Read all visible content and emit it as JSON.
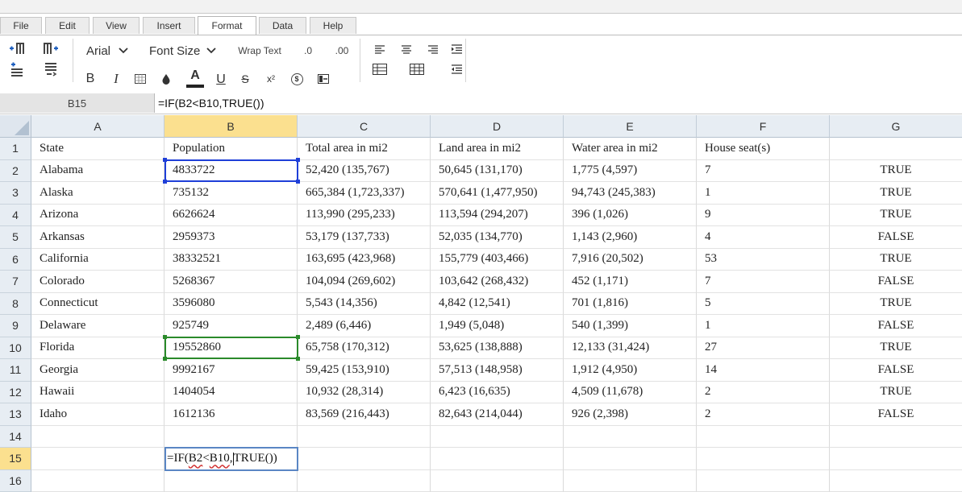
{
  "menu": {
    "tabs": [
      {
        "label": "File"
      },
      {
        "label": "Edit"
      },
      {
        "label": "View"
      },
      {
        "label": "Insert"
      },
      {
        "label": "Format"
      },
      {
        "label": "Data"
      },
      {
        "label": "Help"
      }
    ],
    "active_tab": "Format"
  },
  "toolbar": {
    "font_family": "Arial",
    "font_size": "Font Size",
    "wrap_text": "Wrap Text",
    "decimal_decrease": ".0",
    "decimal_increase": ".00",
    "bold": "B",
    "italic": "I",
    "underline": "U",
    "strike": "S",
    "superscript": "x²",
    "text_color_glyph": "A",
    "currency_glyph": "$"
  },
  "formula_bar": {
    "cell_ref": "B15",
    "formula": "=IF(B2<B10,TRUE())"
  },
  "sheet": {
    "columns": [
      "A",
      "B",
      "C",
      "D",
      "E",
      "F",
      "G"
    ],
    "selected_column": "B",
    "selected_row": "15",
    "rows": [
      {
        "num": "1",
        "cells": [
          "State",
          "Population",
          "Total area in mi2",
          "Land area in mi2",
          "Water area in mi2",
          "House seat(s)",
          ""
        ]
      },
      {
        "num": "2",
        "cells": [
          "Alabama",
          "4833722",
          "52,420 (135,767)",
          "50,645 (131,170)",
          "1,775 (4,597)",
          "7",
          "TRUE"
        ]
      },
      {
        "num": "3",
        "cells": [
          "Alaska",
          "735132",
          "665,384 (1,723,337)",
          "570,641 (1,477,950)",
          "94,743 (245,383)",
          "1",
          "TRUE"
        ]
      },
      {
        "num": "4",
        "cells": [
          "Arizona",
          "6626624",
          "113,990 (295,233)",
          "113,594 (294,207)",
          "396 (1,026)",
          "9",
          "TRUE"
        ]
      },
      {
        "num": "5",
        "cells": [
          "Arkansas",
          "2959373",
          "53,179 (137,733)",
          "52,035 (134,770)",
          "1,143 (2,960)",
          "4",
          "FALSE"
        ]
      },
      {
        "num": "6",
        "cells": [
          "California",
          "38332521",
          "163,695 (423,968)",
          "155,779 (403,466)",
          "7,916 (20,502)",
          "53",
          "TRUE"
        ]
      },
      {
        "num": "7",
        "cells": [
          "Colorado",
          "5268367",
          "104,094 (269,602)",
          "103,642 (268,432)",
          "452 (1,171)",
          "7",
          "FALSE"
        ]
      },
      {
        "num": "8",
        "cells": [
          "Connecticut",
          "3596080",
          "5,543 (14,356)",
          "4,842 (12,541)",
          "701 (1,816)",
          "5",
          "TRUE"
        ]
      },
      {
        "num": "9",
        "cells": [
          "Delaware",
          "925749",
          "2,489 (6,446)",
          "1,949 (5,048)",
          "540 (1,399)",
          "1",
          "FALSE"
        ]
      },
      {
        "num": "10",
        "cells": [
          "Florida",
          "19552860",
          "65,758 (170,312)",
          "53,625 (138,888)",
          "12,133 (31,424)",
          "27",
          "TRUE"
        ]
      },
      {
        "num": "11",
        "cells": [
          "Georgia",
          "9992167",
          "59,425 (153,910)",
          "57,513 (148,958)",
          "1,912 (4,950)",
          "14",
          "FALSE"
        ]
      },
      {
        "num": "12",
        "cells": [
          "Hawaii",
          "1404054",
          "10,932 (28,314)",
          "6,423 (16,635)",
          "4,509 (11,678)",
          "2",
          "TRUE"
        ]
      },
      {
        "num": "13",
        "cells": [
          "Idaho",
          "1612136",
          "83,569 (216,443)",
          "82,643 (214,044)",
          "926 (2,398)",
          "2",
          "FALSE"
        ]
      },
      {
        "num": "14",
        "cells": [
          "",
          "",
          "",
          "",
          "",
          "",
          ""
        ]
      },
      {
        "num": "15",
        "cells": [
          "",
          "",
          "",
          "",
          "",
          "",
          ""
        ]
      },
      {
        "num": "16",
        "cells": [
          "",
          "",
          "",
          "",
          "",
          "",
          ""
        ]
      }
    ],
    "editing": {
      "cell_ref": "B15",
      "parts": [
        "=IF(",
        "B2",
        "<",
        "B10",
        ",",
        "TRUE",
        "())"
      ]
    }
  },
  "colors": {
    "ref_blue": "#1f3fd8",
    "ref_green": "#2a8a2a",
    "selected_header": "#fbe08f",
    "header_bg": "#e7edf3"
  }
}
